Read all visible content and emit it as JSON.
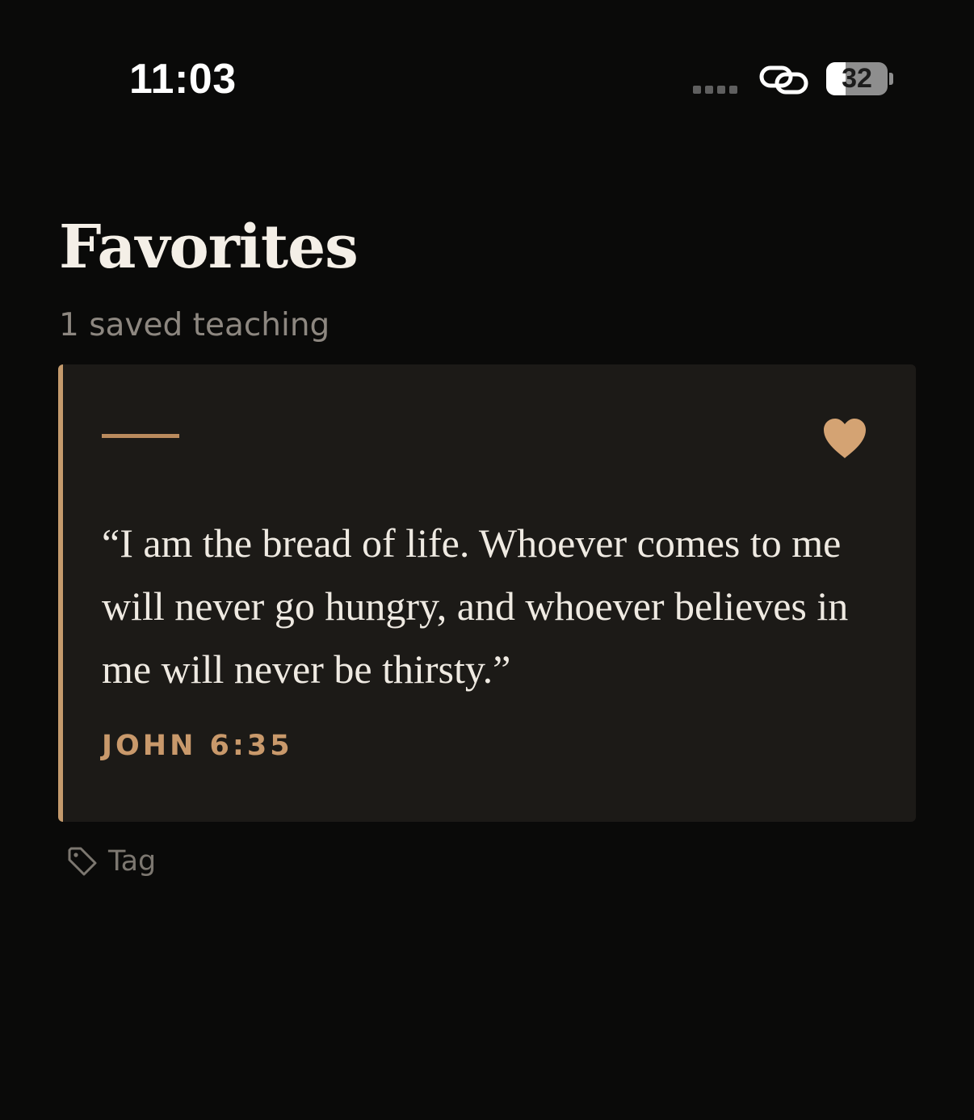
{
  "status_bar": {
    "time": "11:03",
    "battery_level": "32",
    "battery_fill_fraction": 0.32,
    "icons": [
      "signal-dots-icon",
      "link-icon",
      "battery-icon"
    ]
  },
  "header": {
    "title": "Favorites",
    "subtitle": "1 saved teaching"
  },
  "favorites": [
    {
      "quote": "“I am the bread of life. Whoever comes to me will never go hungry, and whoever believes in me will never be thirsty.”",
      "reference": "JOHN 6:35",
      "favorited": true,
      "icon": "heart-icon"
    }
  ],
  "tag": {
    "label": "Tag",
    "icon": "tag-icon"
  },
  "colors": {
    "background": "#0a0a09",
    "card_background": "#1c1a17",
    "accent": "#c9996b",
    "heart": "#d4a373"
  }
}
